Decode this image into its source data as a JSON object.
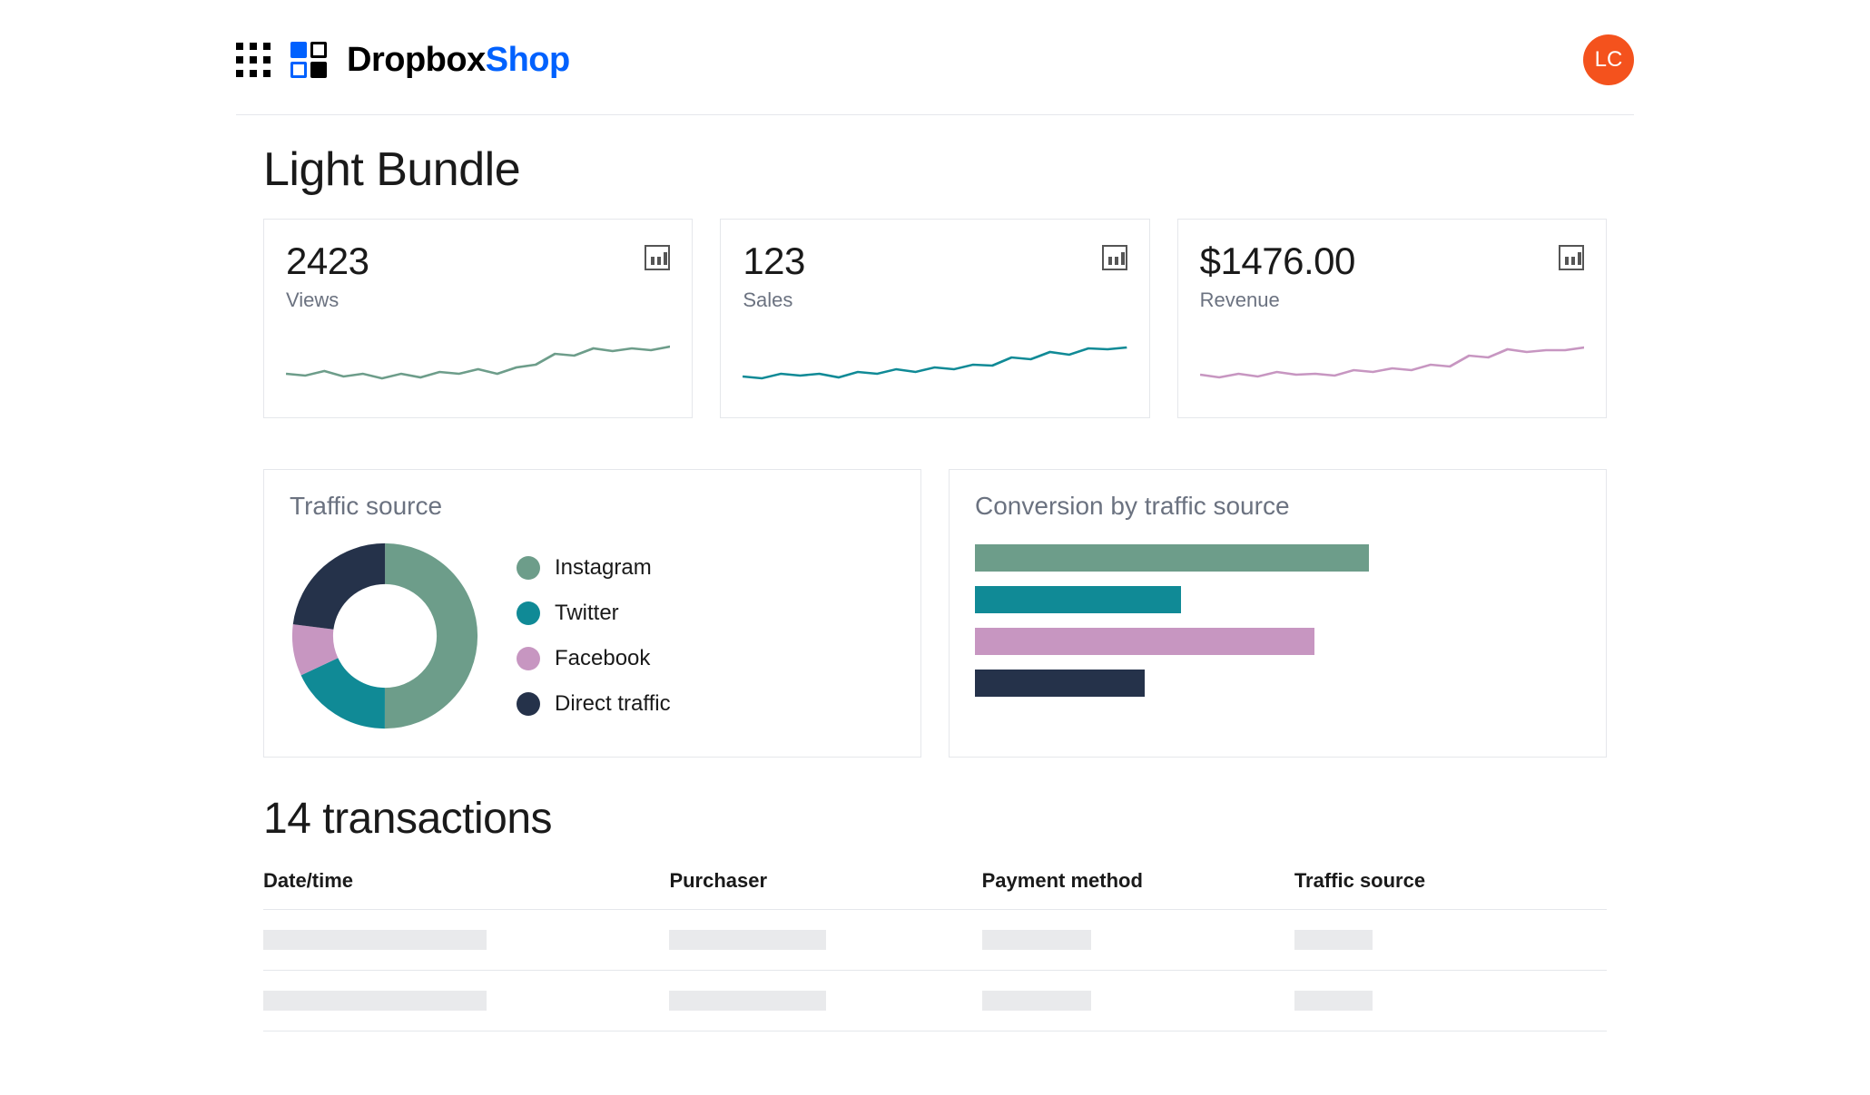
{
  "header": {
    "brand_a": "Dropbox",
    "brand_b": "Shop",
    "avatar_initials": "LC"
  },
  "page_title": "Light Bundle",
  "colors": {
    "instagram": "#6d9d8a",
    "twitter": "#108a96",
    "facebook": "#c796c1",
    "direct": "#25324a"
  },
  "metrics": [
    {
      "key": "views",
      "value": "2423",
      "label": "Views",
      "stroke": "#6d9d8a"
    },
    {
      "key": "sales",
      "value": "123",
      "label": "Sales",
      "stroke": "#108a96"
    },
    {
      "key": "revenue",
      "value": "$1476.00",
      "label": "Revenue",
      "stroke": "#c796c1"
    }
  ],
  "traffic_source": {
    "title": "Traffic source",
    "items": [
      {
        "label": "Instagram",
        "key": "instagram"
      },
      {
        "label": "Twitter",
        "key": "twitter"
      },
      {
        "label": "Facebook",
        "key": "facebook"
      },
      {
        "label": "Direct traffic",
        "key": "direct"
      }
    ]
  },
  "conversion": {
    "title": "Conversion by traffic source"
  },
  "transactions_heading": "14 transactions",
  "table": {
    "columns": [
      "Date/time",
      "Purchaser",
      "Payment method",
      "Traffic source"
    ]
  },
  "chart_data": [
    {
      "type": "pie",
      "title": "Traffic source",
      "note": "donut, values are estimated share percentages",
      "series": [
        {
          "name": "Instagram",
          "value": 50,
          "color": "#6d9d8a"
        },
        {
          "name": "Twitter",
          "value": 18,
          "color": "#108a96"
        },
        {
          "name": "Facebook",
          "value": 9,
          "color": "#c796c1"
        },
        {
          "name": "Direct traffic",
          "value": 23,
          "color": "#25324a"
        }
      ]
    },
    {
      "type": "bar",
      "title": "Conversion by traffic source",
      "note": "relative bar lengths, percent of max width estimated from pixels",
      "categories": [
        "Instagram",
        "Twitter",
        "Facebook",
        "Direct traffic"
      ],
      "values": [
        65,
        34,
        56,
        28
      ],
      "colors": [
        "#6d9d8a",
        "#108a96",
        "#c796c1",
        "#25324a"
      ],
      "xlabel": "",
      "ylabel": "",
      "ylim": [
        0,
        100
      ]
    },
    {
      "type": "line",
      "title": "Views sparkline",
      "note": "y normalized 0-100, approximate",
      "x": [
        0,
        1,
        2,
        3,
        4,
        5,
        6,
        7,
        8,
        9,
        10,
        11,
        12,
        13,
        14,
        15,
        16,
        17,
        18,
        19,
        20
      ],
      "values": [
        50,
        48,
        54,
        47,
        50,
        44,
        50,
        45,
        52,
        50,
        55,
        50,
        57,
        60,
        75,
        72,
        80,
        76,
        80,
        78,
        82
      ],
      "ylim": [
        0,
        100
      ]
    },
    {
      "type": "line",
      "title": "Sales sparkline",
      "note": "y normalized 0-100, approximate",
      "x": [
        0,
        1,
        2,
        3,
        4,
        5,
        6,
        7,
        8,
        9,
        10,
        11,
        12,
        13,
        14,
        15,
        16,
        17,
        18,
        19,
        20
      ],
      "values": [
        45,
        42,
        50,
        46,
        49,
        44,
        52,
        50,
        56,
        52,
        58,
        55,
        62,
        60,
        72,
        68,
        78,
        74,
        84,
        82,
        85
      ],
      "ylim": [
        0,
        100
      ]
    },
    {
      "type": "line",
      "title": "Revenue sparkline",
      "note": "y normalized 0-100, approximate",
      "x": [
        0,
        1,
        2,
        3,
        4,
        5,
        6,
        7,
        8,
        9,
        10,
        11,
        12,
        13,
        14,
        15,
        16,
        17,
        18,
        19,
        20
      ],
      "values": [
        48,
        44,
        50,
        46,
        52,
        48,
        50,
        47,
        55,
        52,
        58,
        55,
        62,
        60,
        75,
        72,
        82,
        78,
        80,
        80,
        85
      ],
      "ylim": [
        0,
        100
      ]
    }
  ]
}
